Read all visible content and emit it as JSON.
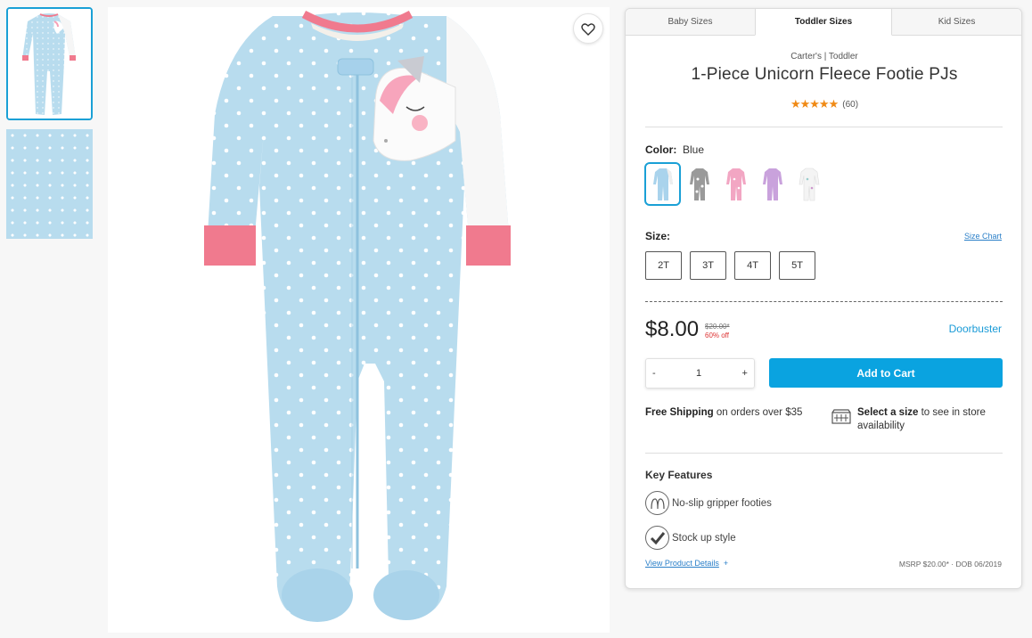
{
  "gallery": {
    "thumbnails": [
      {
        "name": "thumbnail-front-view",
        "selected": true
      },
      {
        "name": "thumbnail-fabric-detail",
        "selected": false
      }
    ],
    "favorite_icon": "heart-icon"
  },
  "tabs": [
    {
      "label": "Baby Sizes",
      "active": false
    },
    {
      "label": "Toddler Sizes",
      "active": true
    },
    {
      "label": "Kid Sizes",
      "active": false
    }
  ],
  "product": {
    "brand_line": "Carter's | Toddler",
    "title": "1-Piece Unicorn Fleece Footie PJs",
    "stars": "★★★★★",
    "rating_count": "(60)",
    "color_label": "Color:",
    "color_value": "Blue",
    "swatches": [
      {
        "name": "swatch-blue",
        "color": "#a9d3ec",
        "selected": true
      },
      {
        "name": "swatch-gray-print",
        "color": "#9a9a9a",
        "selected": false
      },
      {
        "name": "swatch-pink-print",
        "color": "#f2a6c3",
        "selected": false
      },
      {
        "name": "swatch-purple",
        "color": "#c9a2dc",
        "selected": false
      },
      {
        "name": "swatch-white-print",
        "color": "#f0f0f0",
        "selected": false
      }
    ],
    "size_label": "Size:",
    "size_chart": "Size Chart",
    "sizes": [
      "2T",
      "3T",
      "4T",
      "5T"
    ],
    "price": "$8.00",
    "original_price": "$20.00*",
    "discount": "60% off",
    "promo": "Doorbuster",
    "qty_minus": "-",
    "qty_value": "1",
    "qty_plus": "+",
    "add_to_cart": "Add to Cart",
    "shipping_bold": "Free Shipping",
    "shipping_rest": " on orders over $35",
    "store_bold": "Select a size",
    "store_rest": " to see in store availability",
    "key_features_title": "Key Features",
    "features": [
      {
        "text": "No-slip gripper footies",
        "icon": "gripper-footie-icon"
      },
      {
        "text": "Stock up style",
        "icon": "checkmark-icon"
      }
    ],
    "view_details": "View Product Details",
    "view_details_plus": "+",
    "msrp": "MSRP $20.00* · DOB 06/2019"
  },
  "colors": {
    "accent_blue": "#0aa3e0",
    "link_blue": "#2a7fc8",
    "star_orange": "#f08a15",
    "discount_red": "#d33333",
    "pajama_blue": "#b8dcee",
    "cuff_pink": "#f07a8e"
  }
}
